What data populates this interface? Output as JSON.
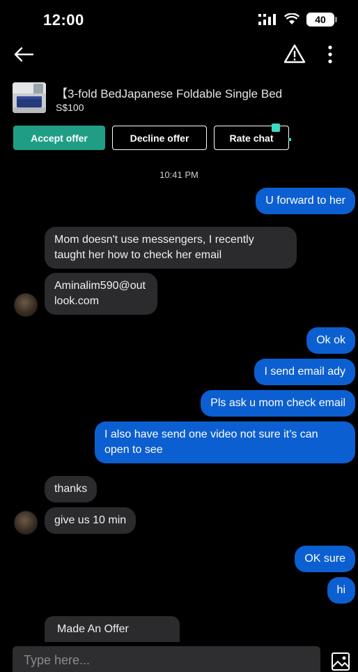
{
  "status_bar": {
    "time": "12:00",
    "battery": "40"
  },
  "listing": {
    "title": "【3-fold BedJapanese Foldable Single Bed",
    "price": "S$100"
  },
  "actions": {
    "accept": "Accept offer",
    "decline": "Decline offer",
    "rate": "Rate chat"
  },
  "timestamp": "10:41 PM",
  "messages": [
    {
      "text": "U forward to her"
    },
    {
      "text": "Mom doesn't use messengers, I recently taught her how to check her email"
    },
    {
      "text": "Aminalim590@outlook.com"
    },
    {
      "text": "Ok ok"
    },
    {
      "text": "I send email ady"
    },
    {
      "text": "Pls ask u mom check email"
    },
    {
      "text": "I also have send one video not sure it’s can open to see"
    },
    {
      "text": "thanks"
    },
    {
      "text": "give us 10 min"
    },
    {
      "text": "OK sure"
    },
    {
      "text": "hi"
    },
    {
      "text": "Made An Offer"
    }
  ],
  "composer": {
    "placeholder": "Type here..."
  },
  "colors": {
    "accent": "#1f9e85",
    "outgoing_bubble": "#0c5fd0",
    "incoming_bubble": "#2b2b2d",
    "background": "#000000"
  }
}
